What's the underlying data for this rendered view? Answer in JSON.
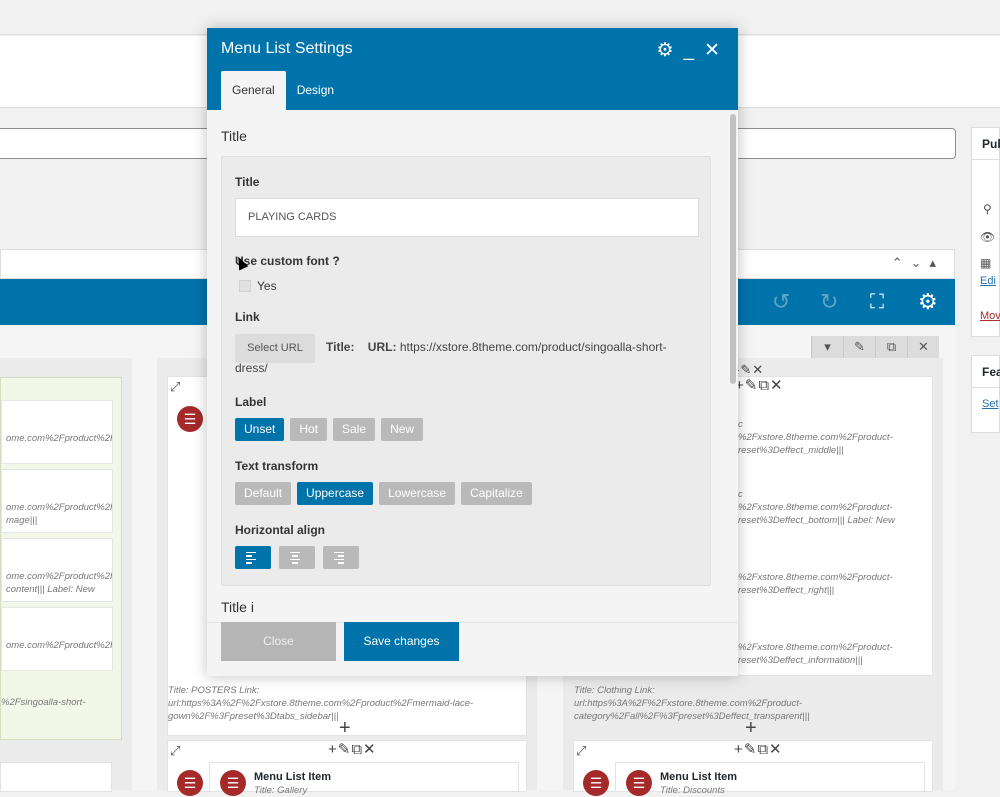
{
  "modal": {
    "title": "Menu List Settings",
    "tabs": [
      {
        "label": "General"
      },
      {
        "label": "Design"
      }
    ],
    "section_title": "Title",
    "section_title_next": "Title i",
    "fields": {
      "title_label": "Title",
      "title_value": "PLAYING CARDS",
      "custom_font_label": "Use custom font ?",
      "custom_font_option": "Yes",
      "link_label": "Link",
      "select_url_button": "Select URL",
      "link_title_label": "Title:",
      "link_url_label": "URL:",
      "link_url_value": "https://xstore.8theme.com/product/singoalla-short-dress/",
      "label_label": "Label",
      "label_options": [
        "Unset",
        "Hot",
        "Sale",
        "New"
      ],
      "label_selected": "Unset",
      "transform_label": "Text transform",
      "transform_options": [
        "Default",
        "Uppercase",
        "Lowercase",
        "Capitalize"
      ],
      "transform_selected": "Uppercase",
      "halign_label": "Horizontal align",
      "halign_selected": "left"
    },
    "footer": {
      "close_label": "Close",
      "save_label": "Save changes"
    },
    "icons": {
      "settings": "gear-icon",
      "minimize": "minimize-icon",
      "close": "close-icon"
    }
  },
  "background": {
    "sidebar": {
      "publish_header": "Pub",
      "featured_header": "Fea",
      "edit_link": "Edi",
      "move_link": "Mov",
      "set_link": "Set"
    },
    "left_column_items": [
      "ome.com%2Fproduct%2Fs",
      "ome.com%2Fproduct%2Fl\nmage|||",
      "ome.com%2Fproduct%2Fl\ncontent||| Label: New",
      "ome.com%2Fproduct%2Fd"
    ],
    "left_column_note": "%2Fsingoalla-short-",
    "middle_column_footer": "Title: POSTERS  Link:\nurl:https%3A%2F%2Fxstore.8theme.com%2Fproduct%2Fmermaid-lace-\ngown%2F%3Fpreset%3Dtabs_sidebar|||",
    "right_column_items": [
      "c\n%2Fxstore.8theme.com%2Fproduct-\nreset%3Deffect_middle|||",
      "c\n%2Fxstore.8theme.com%2Fproduct-\nreset%3Deffect_bottom||| Label: New",
      "%2Fxstore.8theme.com%2Fproduct-\nreset%3Deffect_right|||",
      "%2Fxstore.8theme.com%2Fproduct-\nreset%3Deffect_information|||"
    ],
    "right_column_footer": "Title: Clothing  Link:\nurl:https%3A%2F%2Fxstore.8theme.com%2Fproduct-\ncategory%2Fall%2F%3Fpreset%3Deffect_transparent|||",
    "bottom_item_title": "Menu List Item",
    "bottom_item_sub_middle": "Title: Gallery",
    "bottom_item_sub_right": "Title: Discounts"
  },
  "colors": {
    "accent": "#0073aa",
    "button_off": "#b9b9b9",
    "menu_icon": "#a52a2a",
    "green_box": "#f2f7e7"
  }
}
